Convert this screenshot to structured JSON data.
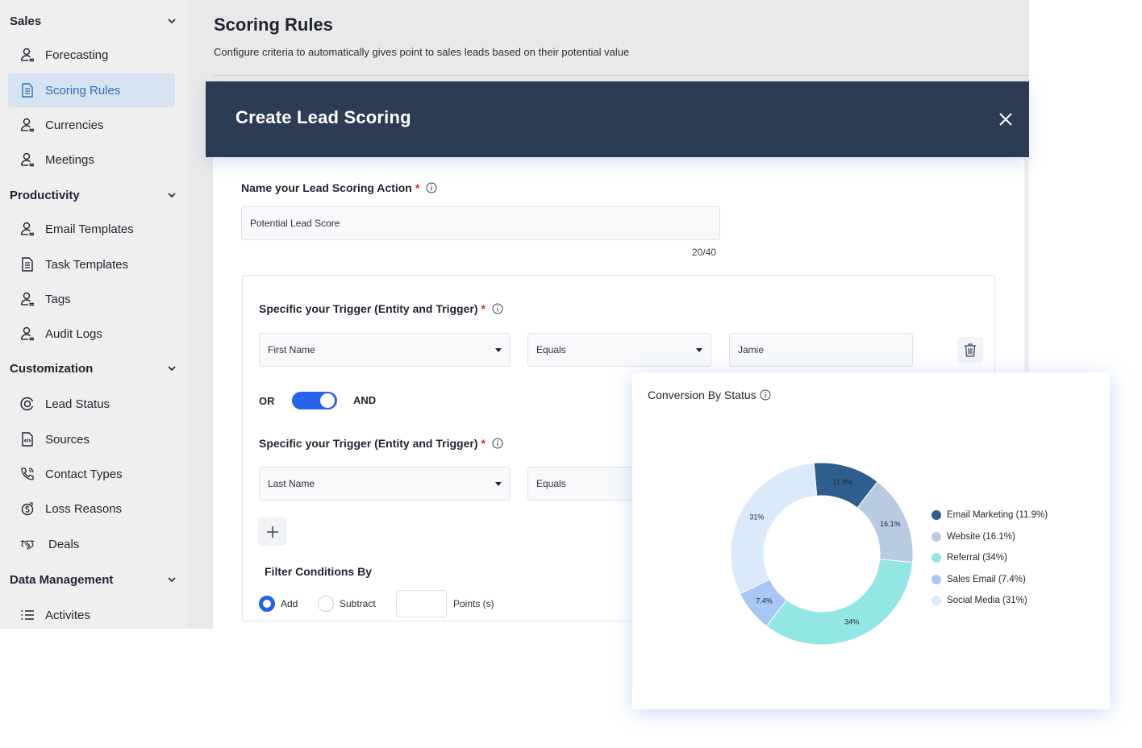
{
  "sidebar": {
    "sections": [
      {
        "label": "Sales"
      },
      {
        "label": "Productivity"
      },
      {
        "label": "Customization"
      },
      {
        "label": "Data Management"
      }
    ],
    "items": [
      {
        "label": "Forecasting",
        "icon": "user-icon"
      },
      {
        "label": "Scoring Rules",
        "icon": "document-icon",
        "active": true
      },
      {
        "label": "Currencies",
        "icon": "user-icon"
      },
      {
        "label": "Meetings",
        "icon": "user-icon"
      },
      {
        "label": "Email Templates",
        "icon": "user-icon"
      },
      {
        "label": "Task Templates",
        "icon": "document-icon"
      },
      {
        "label": "Tags",
        "icon": "user-icon"
      },
      {
        "label": "Audit Logs",
        "icon": "user-icon"
      },
      {
        "label": "Lead Status",
        "icon": "status-icon"
      },
      {
        "label": "Sources",
        "icon": "code-document-icon"
      },
      {
        "label": "Contact Types",
        "icon": "phone-icon"
      },
      {
        "label": "Loss Reasons",
        "icon": "money-icon"
      },
      {
        "label": "Deals",
        "icon": "handshake-icon"
      },
      {
        "label": "Activites",
        "icon": "list-icon"
      }
    ]
  },
  "page": {
    "title": "Scoring Rules",
    "subtitle": "Configure criteria to automatically gives point to sales leads based on their potential value"
  },
  "modal": {
    "title": "Create Lead Scoring",
    "name_label": "Name your Lead Scoring Action",
    "required_mark": "*",
    "name_value": "Potential Lead Score",
    "name_counter": "20/40",
    "trigger_label": "Specific your Trigger (Entity and Trigger)",
    "trigger1": {
      "field": "First Name",
      "operator": "Equals",
      "value": "Jamie"
    },
    "toggle": {
      "left": "OR",
      "right": "AND"
    },
    "trigger2": {
      "field": "Last Name",
      "operator": "Equals"
    },
    "filter_label": "Filter Conditions By",
    "radio_add": "Add",
    "radio_subtract": "Subtract",
    "points_label": "Points (s)"
  },
  "chart_data": {
    "type": "pie",
    "title": "Conversion By Status",
    "categories": [
      "Email Marketing",
      "Website",
      "Referral",
      "Sales Email",
      "Social Media"
    ],
    "values": [
      11.9,
      16.1,
      34,
      7.4,
      31
    ],
    "slice_labels": [
      "11.9%",
      "16.1%",
      "34%",
      "7.4%",
      "31%"
    ],
    "legend": [
      "Email Marketing (11.9%)",
      "Website (16.1%)",
      "Referral (34%)",
      "Sales Email (7.4%)",
      "Social Media (31%)"
    ],
    "colors": [
      "#2d5e8e",
      "#b8cbe1",
      "#92e7e4",
      "#a9c7f4",
      "#dbeafb"
    ],
    "legend_position": "right",
    "donut": true
  }
}
